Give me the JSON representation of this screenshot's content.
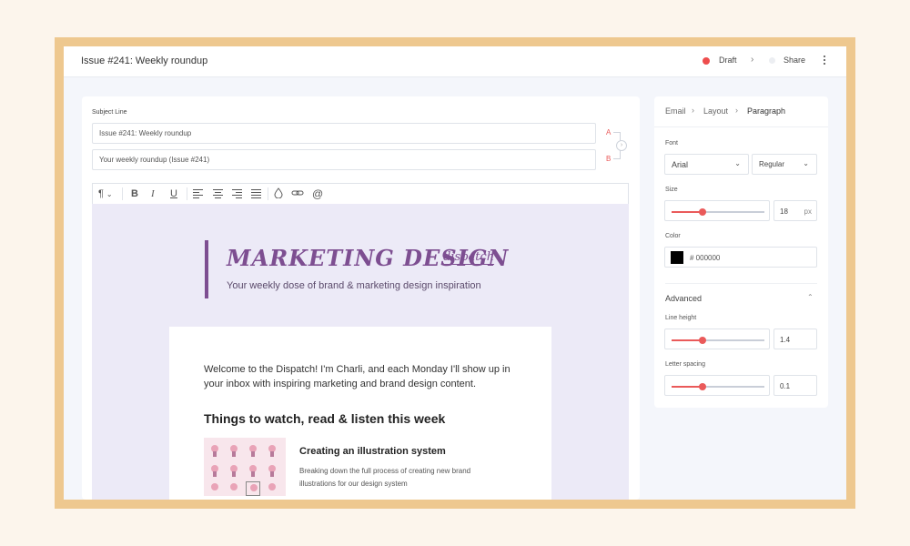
{
  "header": {
    "title": "Issue #241: Weekly roundup",
    "status_label": "Draft",
    "share_label": "Share",
    "status_color": "#ee4d4d"
  },
  "editor": {
    "subject_label": "Subject Line",
    "subject_a": "Issue #241: Weekly roundup",
    "subject_b": "Your weekly roundup (Issue #241)",
    "variant_a": "A",
    "variant_b": "B",
    "toolbar": {
      "paragraph": "¶",
      "bold": "B",
      "italic": "I",
      "underline": "U",
      "mention": "@"
    }
  },
  "email": {
    "brand_title": "MARKETING DESIGN",
    "brand_script": "dispatch",
    "tagline": "Your weekly dose of brand & marketing design inspiration",
    "welcome": "Welcome to the Dispatch! I'm Charli, and each Monday I'll show up in your inbox with inspiring marketing and brand design content.",
    "section_title": "Things to watch, read & listen this week",
    "article_title": "Creating an illustration system",
    "article_desc": "Breaking down the full process of creating new brand illustrations for our design system",
    "brand_color": "#7d4e91"
  },
  "properties": {
    "breadcrumb": [
      "Email",
      "Layout",
      "Paragraph"
    ],
    "font_label": "Font",
    "font_value": "Arial",
    "weight_value": "Regular",
    "size_label": "Size",
    "size_value": "18",
    "size_unit": "px",
    "size_level": 0.33,
    "color_label": "Color",
    "color_value": "# 000000",
    "advanced_label": "Advanced",
    "line_height_label": "Line height",
    "line_height_value": "1.4",
    "line_height_level": 0.33,
    "letter_spacing_label": "Letter spacing",
    "letter_spacing_value": "0.1",
    "letter_spacing_level": 0.33,
    "accent_color": "#ea5a5a"
  }
}
